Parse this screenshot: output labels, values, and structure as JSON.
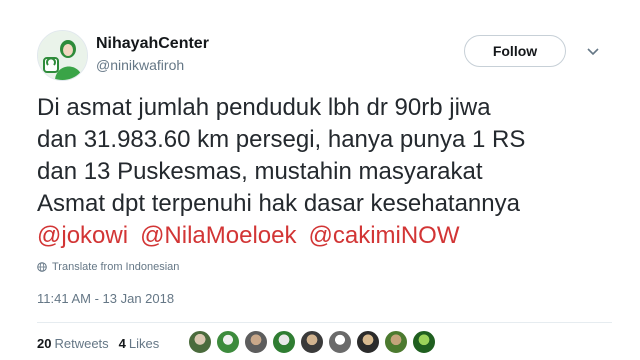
{
  "author": {
    "display_name": "NihayahCenter",
    "handle": "@ninikwafiroh",
    "avatar_icon": "profile-avatar-green-logo"
  },
  "follow": {
    "label": "Follow",
    "caret_icon": "chevron-down-icon"
  },
  "tweet": {
    "lines": [
      "Di asmat jumlah penduduk lbh dr 90rb jiwa",
      "dan 31.983.60 km persegi, hanya punya 1 RS",
      "dan 13 Puskesmas, mustahin masyarakat",
      "Asmat dpt terpenuhi hak dasar kesehatannya"
    ],
    "mentions": [
      "@jokowi",
      "@NilaMoeloek",
      "@cakimiNOW"
    ]
  },
  "translate_label": "Translate from Indonesian",
  "timestamp": "11:41 AM - 13 Jan 2018",
  "stats": {
    "retweets_count": "20",
    "retweets_label": "Retweets",
    "likes_count": "4",
    "likes_label": "Likes"
  },
  "colors": {
    "mention": "#d23535",
    "secondary_text": "#657786",
    "primary_text": "#14171a"
  }
}
